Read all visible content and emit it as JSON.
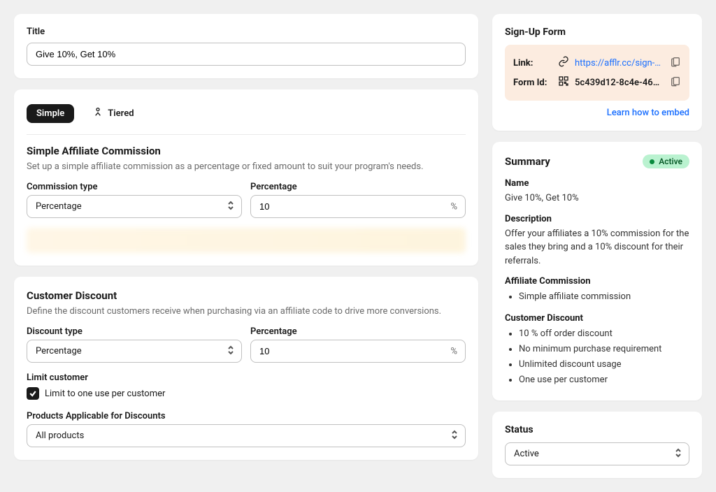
{
  "title_section": {
    "label": "Title",
    "value": "Give 10%, Get 10%"
  },
  "tabs": {
    "simple": "Simple",
    "tiered": "Tiered"
  },
  "commission": {
    "heading": "Simple Affiliate Commission",
    "sub": "Set up a simple affiliate commission as a percentage or fixed amount to suit your program's needs.",
    "type_label": "Commission type",
    "type_value": "Percentage",
    "pct_label": "Percentage",
    "pct_value": "10",
    "pct_suffix": "%"
  },
  "discount": {
    "heading": "Customer Discount",
    "sub": "Define the discount customers receive when purchasing via an affiliate code to drive more conversions.",
    "type_label": "Discount type",
    "type_value": "Percentage",
    "pct_label": "Percentage",
    "pct_value": "10",
    "pct_suffix": "%",
    "limit_label": "Limit customer",
    "limit_checkbox": "Limit to one use per customer",
    "products_label": "Products Applicable for Discounts",
    "products_value": "All products"
  },
  "signup": {
    "heading": "Sign-Up Form",
    "link_label": "Link:",
    "link_value": "https://afflr.cc/sign-up/...",
    "formid_label": "Form Id:",
    "formid_value": "5c439d12-8c4e-4610...",
    "learn": "Learn how to embed"
  },
  "summary": {
    "heading": "Summary",
    "badge": "Active",
    "name_label": "Name",
    "name_value": "Give 10%, Get 10%",
    "desc_label": "Description",
    "desc_value": "Offer your affiliates a 10% commission for the sales they bring and a 10% discount for their referrals.",
    "comm_label": "Affiliate Commission",
    "comm_items": [
      "Simple affiliate commission"
    ],
    "disc_label": "Customer Discount",
    "disc_items": [
      "10 % off order discount",
      "No minimum purchase requirement",
      "Unlimited discount usage",
      "One use per customer"
    ]
  },
  "status": {
    "heading": "Status",
    "value": "Active"
  }
}
